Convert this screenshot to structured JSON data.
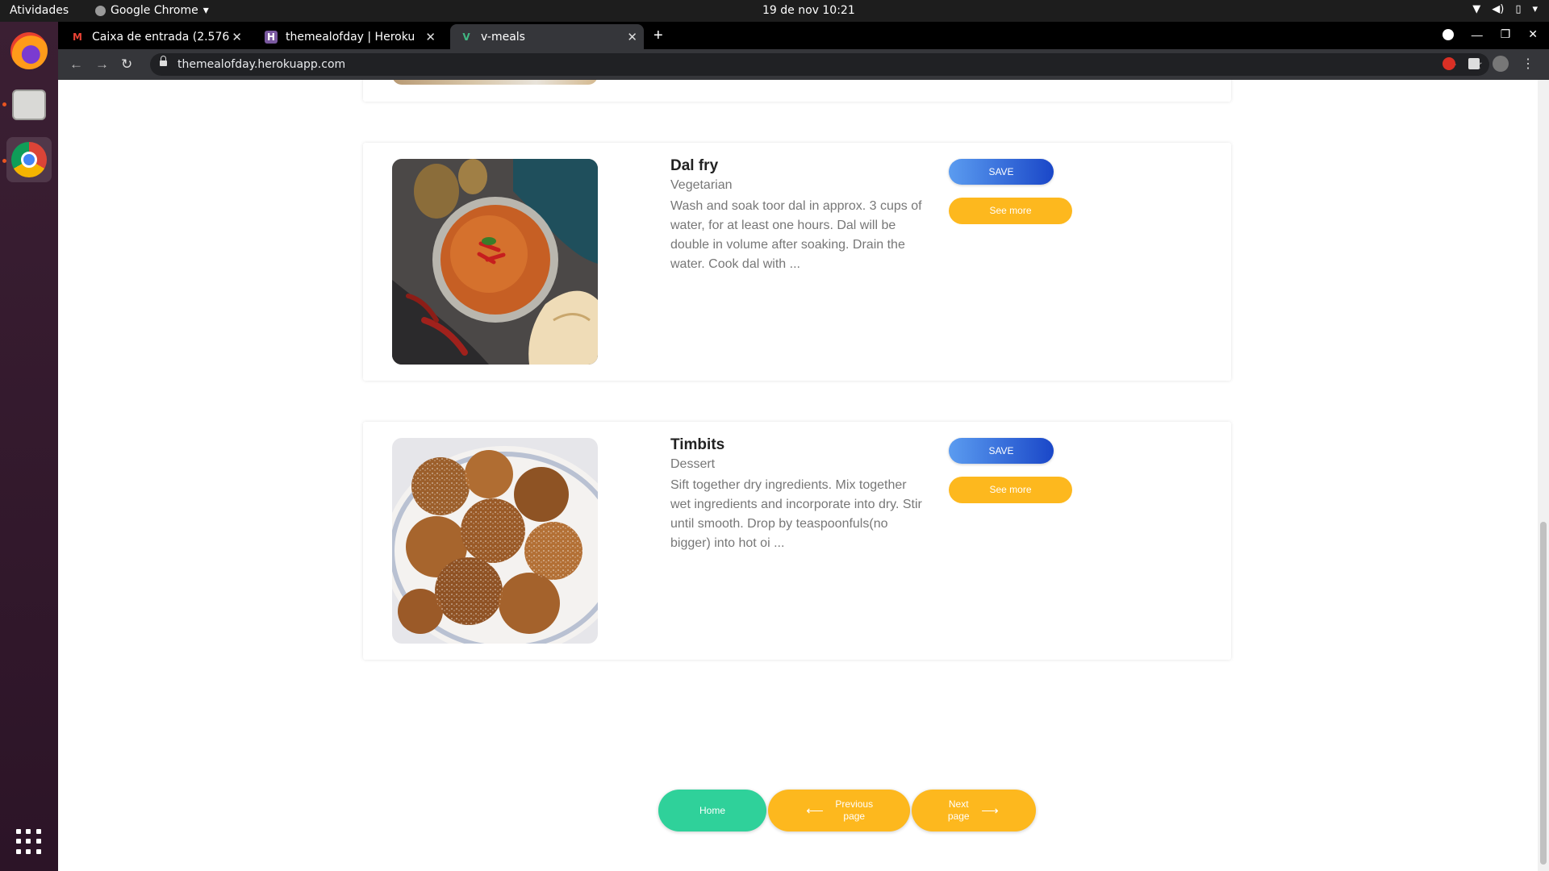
{
  "system": {
    "activities": "Atividades",
    "app_menu": "Google Chrome",
    "clock": "19 de nov  10:21"
  },
  "browser": {
    "tabs": [
      {
        "label": "Caixa de entrada (2.576) -",
        "icon": "gmail-icon"
      },
      {
        "label": "themealofday | Heroku",
        "icon": "heroku-icon"
      },
      {
        "label": "v-meals",
        "icon": "vue-icon"
      }
    ],
    "url": "themealofday.herokuapp.com"
  },
  "meals": [
    {
      "title": "Dal fry",
      "category": "Vegetarian",
      "description": "Wash and soak toor dal in approx. 3 cups of water, for at least one hours. Dal will be double in volume after soaking. Drain the water. Cook dal with ...",
      "save_label": "SAVE",
      "more_label": "See more"
    },
    {
      "title": "Timbits",
      "category": "Dessert",
      "description": "Sift together dry ingredients. Mix together wet ingredients and incorporate into dry. Stir until smooth. Drop by teaspoonfuls(no bigger) into hot oi ...",
      "save_label": "SAVE",
      "more_label": "See more"
    }
  ],
  "pagination": {
    "home": "Home",
    "previous": "Previous page",
    "next": "Next page"
  },
  "colors": {
    "save_button": "#1a47c8",
    "see_more_button": "#fdb81e",
    "home_button": "#2fd19a"
  }
}
